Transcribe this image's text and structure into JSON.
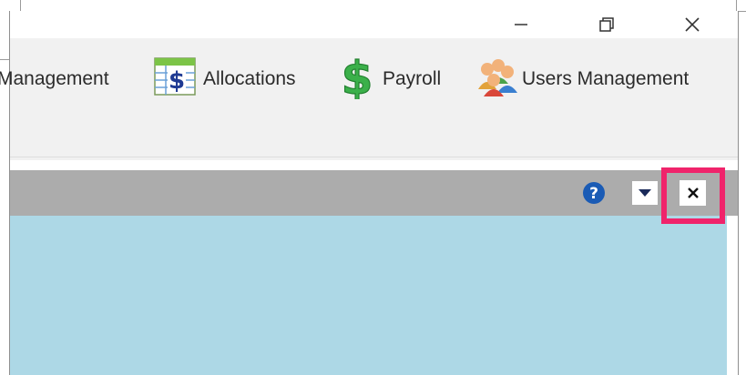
{
  "window": {
    "controls": [
      "minimize",
      "restore",
      "close"
    ]
  },
  "ribbon": {
    "items": [
      {
        "label": "Management",
        "visible_text": "Management",
        "icon": "management-icon"
      },
      {
        "label": "Allocations",
        "icon": "spreadsheet-dollar-icon"
      },
      {
        "label": "Payroll",
        "icon": "dollar-sign-icon"
      },
      {
        "label": "Users Management",
        "icon": "users-icon"
      }
    ]
  },
  "document_header": {
    "buttons": [
      "help",
      "dropdown",
      "close"
    ]
  },
  "colors": {
    "ribbon_bg": "#f1f1f1",
    "header_bg": "#acacac",
    "content_bg": "#add8e6",
    "highlight": "#f0246b",
    "help_blue": "#1a5bb5"
  }
}
